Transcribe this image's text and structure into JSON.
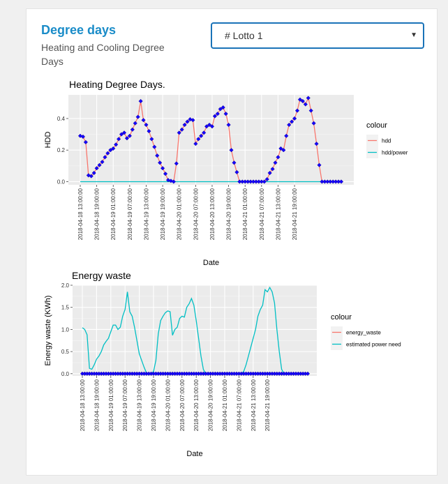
{
  "header": {
    "title": "Degree days",
    "subtitle": "Heating and Cooling Degree Days"
  },
  "selector": {
    "selected": "# Lotto 1"
  },
  "chart_data": [
    {
      "type": "line",
      "title": "Heating Degree Days.",
      "xlabel": "Date",
      "ylabel": "HDD",
      "ylim": [
        -0.02,
        0.55
      ],
      "yticks": [
        "0.0",
        "0.2",
        "0.4"
      ],
      "ytick_values": [
        0,
        0.2,
        0.4
      ],
      "xtick_labels": [
        "2018-04-18 13:00:00",
        "2018-04-18 19:00:00",
        "2018-04-19 01:00:00",
        "2018-04-19 07:00:00",
        "2018-04-19 13:00:00",
        "2018-04-19 19:00:00",
        "2018-04-20 01:00:00",
        "2018-04-20 07:00:00",
        "2018-04-20 13:00:00",
        "2018-04-20 19:00:00",
        "2018-04-21 01:00:00",
        "2018-04-21 07:00:00",
        "2018-04-21 13:00:00",
        "2018-04-21 19:00:00"
      ],
      "x_hours_start": "2018-04-18 13:00:00",
      "legend_title": "colour",
      "legend_position": "right",
      "grid": true,
      "series": [
        {
          "name": "hdd",
          "color": "#f8766d",
          "markers": true,
          "values": [
            0.29,
            0.285,
            0.25,
            0.04,
            0.035,
            0.055,
            0.085,
            0.105,
            0.125,
            0.155,
            0.18,
            0.2,
            0.21,
            0.235,
            0.27,
            0.3,
            0.31,
            0.275,
            0.29,
            0.33,
            0.37,
            0.41,
            0.51,
            0.39,
            0.36,
            0.32,
            0.27,
            0.22,
            0.165,
            0.12,
            0.085,
            0.05,
            0.01,
            0.005,
            0.0,
            0.115,
            0.31,
            0.33,
            0.36,
            0.38,
            0.395,
            0.39,
            0.24,
            0.27,
            0.29,
            0.31,
            0.35,
            0.36,
            0.35,
            0.415,
            0.43,
            0.46,
            0.47,
            0.43,
            0.36,
            0.2,
            0.12,
            0.06,
            0.0,
            0.0,
            0.0,
            0.0,
            0.0,
            0.0,
            0.0,
            0.0,
            0.0,
            0.0,
            0.015,
            0.055,
            0.08,
            0.12,
            0.155,
            0.21,
            0.2,
            0.29,
            0.36,
            0.38,
            0.4,
            0.45,
            0.52,
            0.51,
            0.49,
            0.53,
            0.45,
            0.37,
            0.24,
            0.105,
            0.0,
            0.0,
            0.0,
            0.0,
            0.0,
            0.0,
            0.0,
            0.0
          ]
        },
        {
          "name": "hdd/power",
          "color": "#00bfc4",
          "markers": false,
          "values": [
            0,
            0,
            0,
            0,
            0,
            0,
            0,
            0,
            0,
            0,
            0,
            0,
            0,
            0,
            0,
            0,
            0,
            0,
            0,
            0,
            0,
            0,
            0,
            0,
            0,
            0,
            0,
            0,
            0,
            0,
            0,
            0,
            0,
            0,
            0,
            0,
            0,
            0,
            0,
            0,
            0,
            0,
            0,
            0,
            0,
            0,
            0,
            0,
            0,
            0,
            0,
            0,
            0,
            0,
            0,
            0,
            0,
            0,
            0,
            0,
            0,
            0,
            0,
            0,
            0,
            0,
            0,
            0,
            0,
            0,
            0,
            0,
            0,
            0,
            0,
            0,
            0,
            0,
            0,
            0,
            0,
            0,
            0,
            0,
            0,
            0,
            0,
            0,
            0,
            0,
            0,
            0,
            0,
            0,
            0,
            0
          ]
        }
      ]
    },
    {
      "type": "line",
      "title": "Energy waste",
      "xlabel": "Date",
      "ylabel": "Energy waste (KWh)",
      "ylim": [
        -0.05,
        2.0
      ],
      "yticks": [
        "0.0",
        "0.5",
        "1.0",
        "1.5",
        "2.0"
      ],
      "ytick_values": [
        0,
        0.5,
        1.0,
        1.5,
        2.0
      ],
      "xtick_labels": [
        "2018-04-18 13:00:00",
        "2018-04-18 19:00:00",
        "2018-04-19 01:00:00",
        "2018-04-19 07:00:00",
        "2018-04-19 13:00:00",
        "2018-04-19 19:00:00",
        "2018-04-20 01:00:00",
        "2018-04-20 07:00:00",
        "2018-04-20 13:00:00",
        "2018-04-20 19:00:00",
        "2018-04-21 01:00:00",
        "2018-04-21 07:00:00",
        "2018-04-21 13:00:00",
        "2018-04-21 19:00:00"
      ],
      "legend_title": "colour",
      "legend_position": "right",
      "grid": true,
      "series": [
        {
          "name": "energy_waste",
          "color": "#0000ff",
          "markers": true,
          "values": [
            0,
            0,
            0,
            0,
            0,
            0,
            0,
            0,
            0,
            0,
            0,
            0,
            0,
            0,
            0,
            0,
            0,
            0,
            0,
            0,
            0,
            0,
            0,
            0,
            0,
            0,
            0,
            0,
            0,
            0,
            0,
            0,
            0,
            0,
            0,
            0,
            0,
            0,
            0,
            0,
            0,
            0,
            0,
            0,
            0,
            0,
            0,
            0,
            0,
            0,
            0,
            0,
            0,
            0,
            0,
            0,
            0,
            0,
            0,
            0,
            0,
            0,
            0,
            0,
            0,
            0,
            0,
            0,
            0,
            0,
            0,
            0,
            0,
            0,
            0,
            0,
            0,
            0,
            0,
            0,
            0,
            0,
            0,
            0,
            0,
            0,
            0,
            0,
            0,
            0,
            0,
            0,
            0,
            0,
            0,
            0
          ]
        },
        {
          "name": "estimated power need",
          "color": "#00bfc4",
          "markers": false,
          "values": [
            1.04,
            1.0,
            0.88,
            0.12,
            0.1,
            0.2,
            0.33,
            0.4,
            0.5,
            0.65,
            0.73,
            0.8,
            0.95,
            1.1,
            1.1,
            1.0,
            1.05,
            1.3,
            1.45,
            1.85,
            1.4,
            1.3,
            1.05,
            0.75,
            0.45,
            0.3,
            0.15,
            0.02,
            0.0,
            0.0,
            0.05,
            0.3,
            0.9,
            1.2,
            1.3,
            1.38,
            1.42,
            1.4,
            0.87,
            1.0,
            1.05,
            1.25,
            1.3,
            1.28,
            1.5,
            1.58,
            1.7,
            1.55,
            1.2,
            0.8,
            0.4,
            0.1,
            0.0,
            0.0,
            0.0,
            0.0,
            0.0,
            0.0,
            0.0,
            0.0,
            0.0,
            0.0,
            0.0,
            0.0,
            0.0,
            0.0,
            0.0,
            0.0,
            0.05,
            0.2,
            0.4,
            0.6,
            0.8,
            1.0,
            1.3,
            1.45,
            1.55,
            1.9,
            1.85,
            1.95,
            1.85,
            1.6,
            1.0,
            0.5,
            0.1,
            0.0,
            0.0,
            0.0,
            0.0,
            0.0,
            0.0,
            0.0,
            0.0,
            0.0,
            0.0,
            0.0
          ]
        }
      ]
    }
  ]
}
